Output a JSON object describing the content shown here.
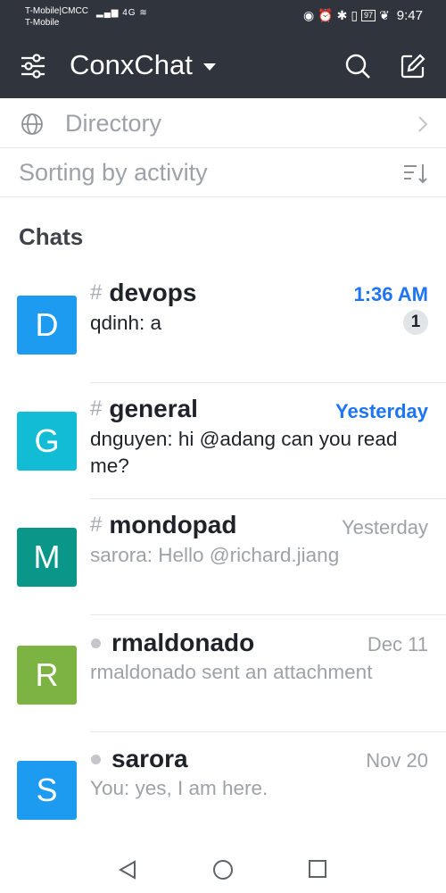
{
  "status_bar": {
    "carrier_line1": "T-Mobile|CMCC",
    "carrier_line2": "T-Mobile",
    "signal": "4G",
    "battery": "97",
    "time": "9:47"
  },
  "header": {
    "title": "ConxChat",
    "icons": [
      "sliders-icon",
      "chevron-down-icon",
      "search-icon",
      "compose-icon"
    ]
  },
  "directory": {
    "label": "Directory"
  },
  "sorting": {
    "label": "Sorting by activity"
  },
  "section_title": "Chats",
  "chats": [
    {
      "type": "channel",
      "avatar_letter": "D",
      "avatar_color": "#1d9bf0",
      "name": "devops",
      "time": "1:36 AM",
      "preview": "qdinh: a",
      "unread_count": "1",
      "unread": true
    },
    {
      "type": "channel",
      "avatar_letter": "G",
      "avatar_color": "#12bcd4",
      "name": "general",
      "time": "Yesterday",
      "preview": "dnguyen: hi @adang can you read me?",
      "unread": true
    },
    {
      "type": "channel",
      "avatar_letter": "M",
      "avatar_color": "#0a9688",
      "name": "mondopad",
      "time": "Yesterday",
      "preview": "sarora: Hello @richard.jiang",
      "unread": false
    },
    {
      "type": "direct",
      "avatar_letter": "R",
      "avatar_color": "#7cb342",
      "name": "rmaldonado",
      "time": "Dec 11",
      "preview": "rmaldonado sent an attachment",
      "unread": false
    },
    {
      "type": "direct",
      "avatar_letter": "S",
      "avatar_color": "#1d9bf0",
      "name": "sarora",
      "time": "Nov 20",
      "preview": "You: yes, I am here.",
      "unread": false
    }
  ],
  "colors": {
    "header_bg": "#2f343d",
    "accent_blue": "#1d74f5",
    "muted_text": "#9ea2a8"
  }
}
